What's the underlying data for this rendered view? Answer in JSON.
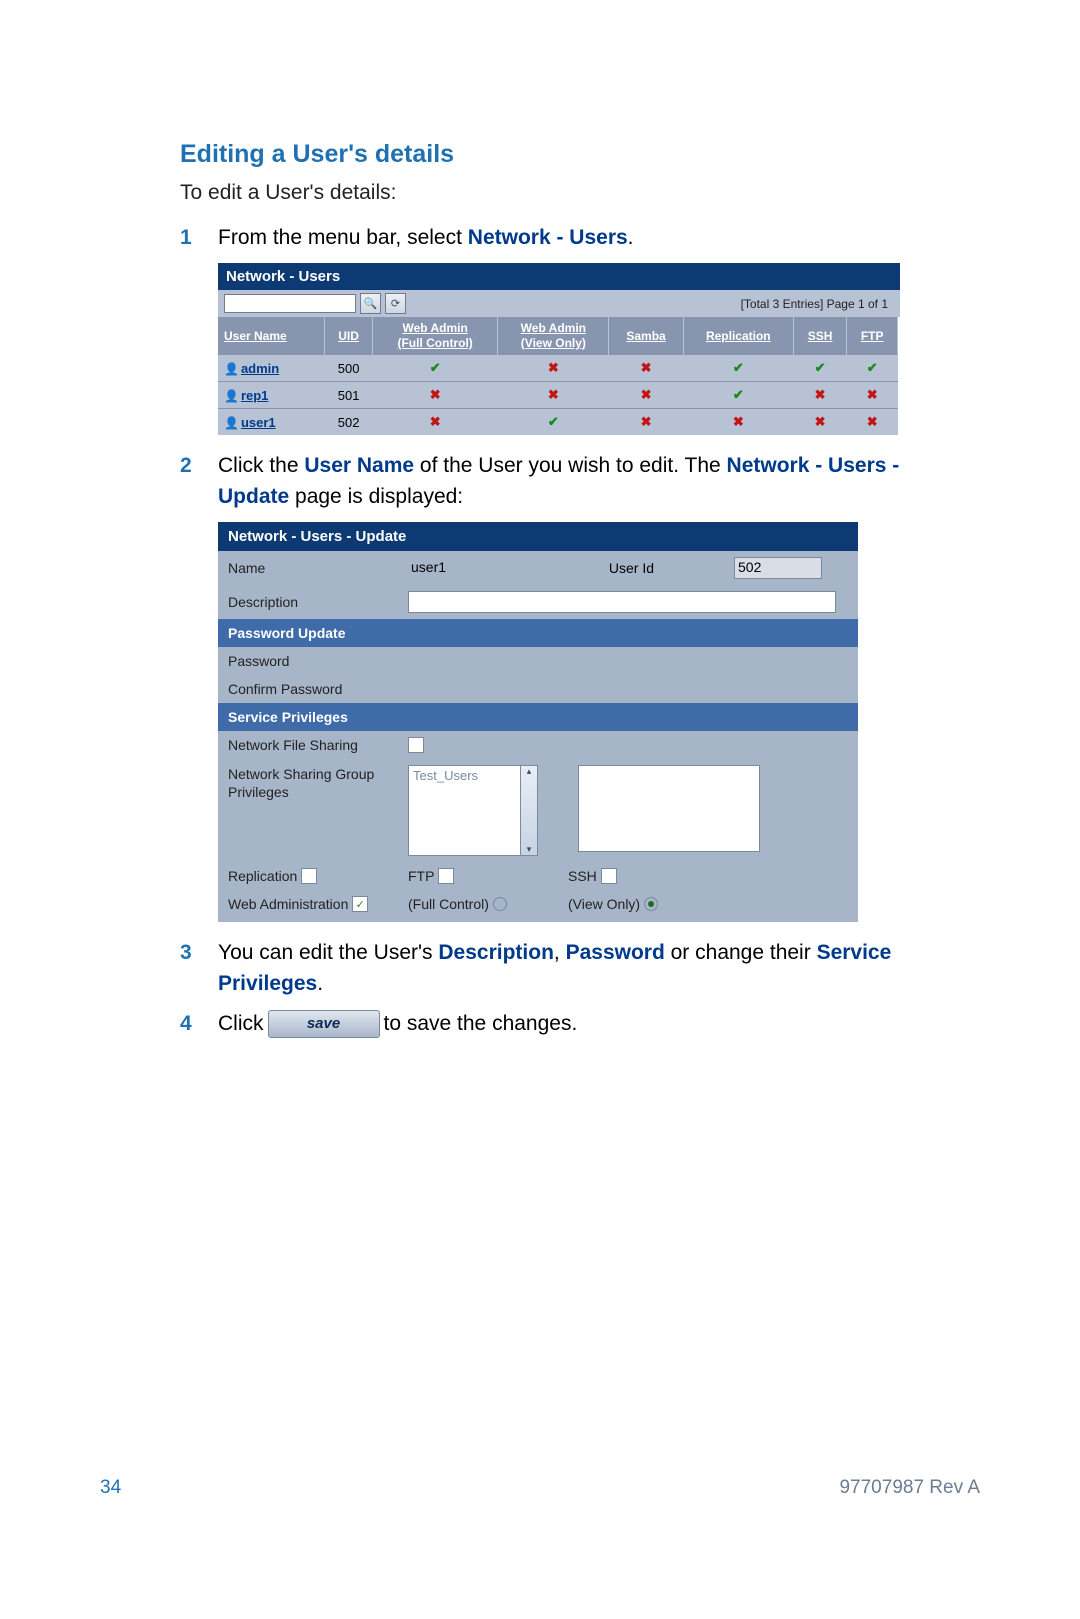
{
  "heading": "Editing a User's details",
  "intro": "To edit a User's details:",
  "steps": {
    "s1": {
      "num": "1",
      "pre": "From the menu bar, select ",
      "bold": "Network - Users",
      "post": "."
    },
    "s2a": "Click the ",
    "s2_username": "User Name",
    "s2b": " of the User you wish to edit. The ",
    "s2_page": "Network - Users - Update",
    "s2c": " page is displayed:",
    "s2num": "2",
    "s3num": "3",
    "s3a": "You can edit the User's ",
    "s3_desc": "Description",
    "s3_comma": ", ",
    "s3_pw": "Password",
    "s3b": " or change their ",
    "s3_sp": "Service Privileges",
    "s3c": ".",
    "s4num": "4",
    "s4a": "Click ",
    "s4_save": "save",
    "s4b": " to save the changes."
  },
  "table1": {
    "title": "Network - Users",
    "summary": "[Total 3 Entries] Page 1 of 1",
    "headers": {
      "h0": "User Name",
      "h1": "UID",
      "h2": "Web Admin\n(Full Control)",
      "h3": "Web Admin\n(View Only)",
      "h4": "Samba",
      "h5": "Replication",
      "h6": "SSH",
      "h7": "FTP"
    },
    "rows": [
      {
        "name": "admin",
        "uid": "500",
        "v": [
          "y",
          "n",
          "n",
          "y",
          "y",
          "y"
        ]
      },
      {
        "name": "rep1",
        "uid": "501",
        "v": [
          "n",
          "n",
          "n",
          "y",
          "n",
          "n"
        ]
      },
      {
        "name": "user1",
        "uid": "502",
        "v": [
          "n",
          "y",
          "n",
          "n",
          "n",
          "n"
        ]
      }
    ]
  },
  "form": {
    "title": "Network - Users - Update",
    "labels": {
      "name": "Name",
      "userid": "User Id",
      "description": "Description",
      "pwupdate": "Password Update",
      "password": "Password",
      "confirm": "Confirm Password",
      "svcpriv": "Service Privileges",
      "nfs": "Network File Sharing",
      "ngroup": "Network Sharing Group Privileges",
      "replication": "Replication",
      "ftp": "FTP",
      "ssh": "SSH",
      "webadmin": "Web Administration",
      "fullcontrol": "(Full Control)",
      "viewonly": "(View Only)"
    },
    "values": {
      "name": "user1",
      "userid": "502",
      "groupItem": "Test_Users"
    }
  },
  "footer": {
    "page": "34",
    "rev": "97707987 Rev A"
  }
}
